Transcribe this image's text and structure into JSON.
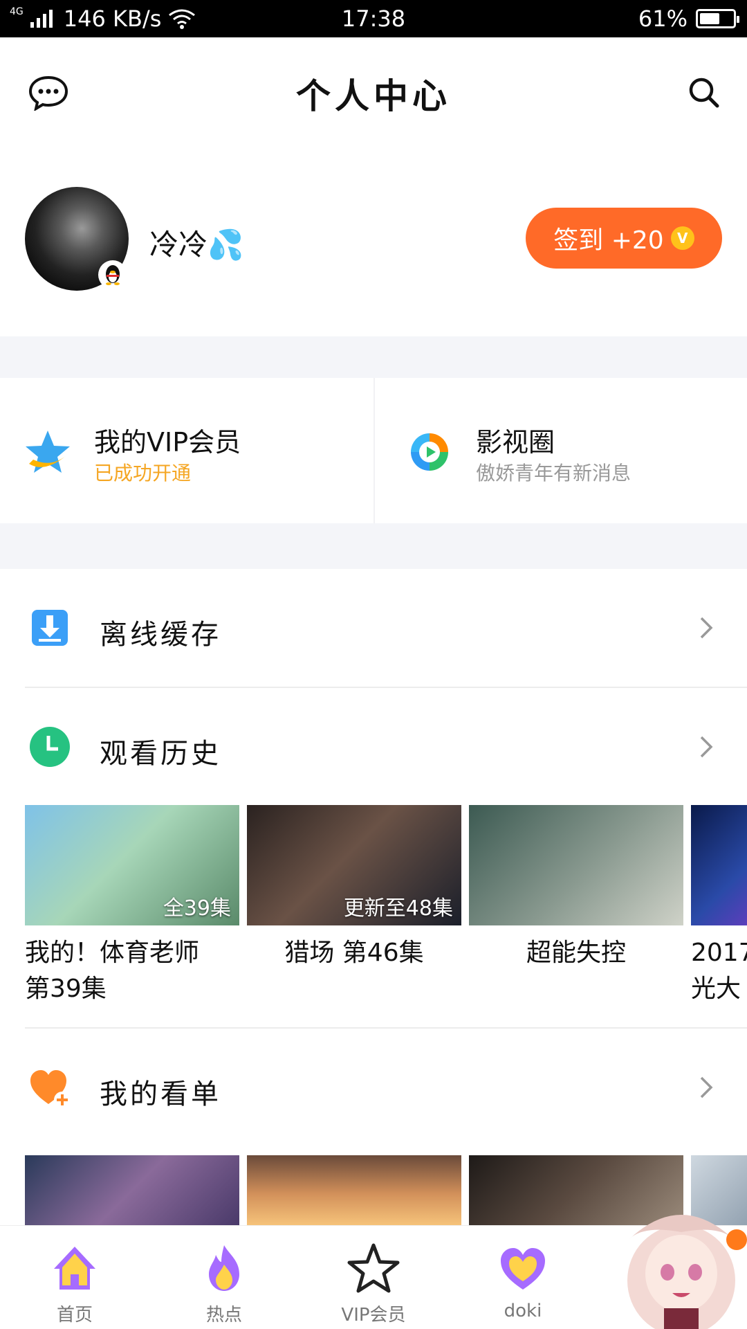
{
  "status_bar": {
    "network": "4G",
    "speed": "146 KB/s",
    "time": "17:38",
    "battery": "61%",
    "battery_level": 0.61
  },
  "header": {
    "title": "个人中心",
    "left_icon": "message-icon",
    "right_icon": "search-icon"
  },
  "profile": {
    "username": "冷冷💦",
    "checkin_label": "签到 +20",
    "coin_glyph": "V",
    "accent": "#ff6a28"
  },
  "cards": {
    "vip": {
      "title": "我的VIP会员",
      "subtitle": "已成功开通",
      "subtitle_color": "#f5a623",
      "icon": "vip-star-icon"
    },
    "film": {
      "title": "影视圈",
      "subtitle": "傲娇青年有新消息",
      "subtitle_color": "#999999",
      "icon": "film-circle-icon"
    }
  },
  "rows": {
    "offline": {
      "label": "离线缓存",
      "icon": "download-icon"
    },
    "history": {
      "label": "观看历史",
      "icon": "clock-icon"
    },
    "watchlist": {
      "label": "我的看单",
      "icon": "heart-plus-icon"
    }
  },
  "history": [
    {
      "badge": "全39集",
      "caption": "我的！体育老师\n第39集"
    },
    {
      "badge": "更新至48集",
      "caption": "猎场 第46集"
    },
    {
      "badge": "",
      "caption": "超能失控"
    },
    {
      "badge": "",
      "caption": "2017\n光大"
    }
  ],
  "nav": [
    {
      "label": "首页",
      "icon": "home-icon"
    },
    {
      "label": "热点",
      "icon": "flame-icon"
    },
    {
      "label": "VIP会员",
      "icon": "vip-star-outline-icon"
    },
    {
      "label": "doki",
      "icon": "doki-heart-icon"
    }
  ]
}
